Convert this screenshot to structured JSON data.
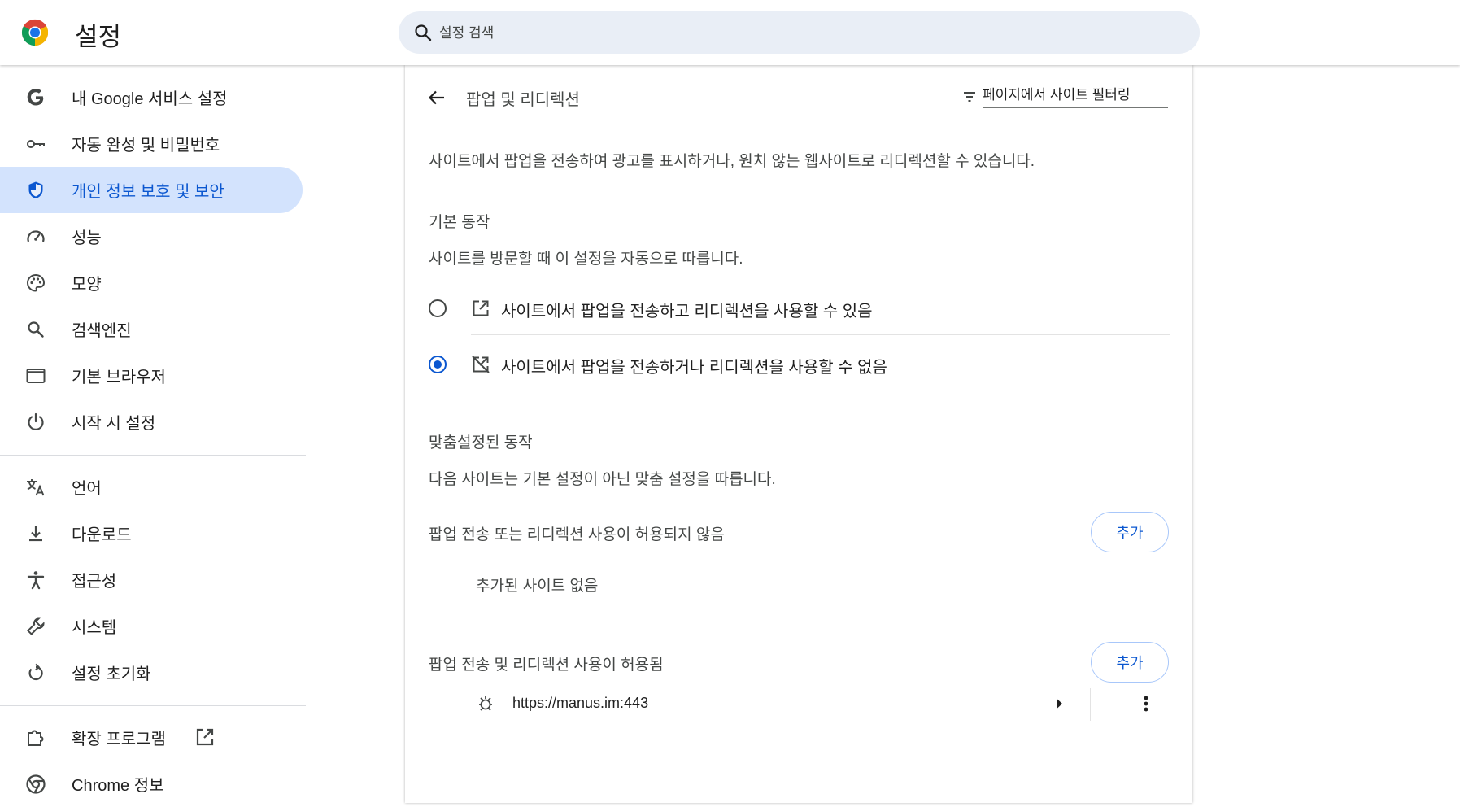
{
  "header": {
    "title": "설정",
    "search_placeholder": "설정 검색"
  },
  "sidebar": {
    "items": [
      {
        "label": "내 Google 서비스 설정",
        "icon": "google-g-icon"
      },
      {
        "label": "자동 완성 및 비밀번호",
        "icon": "key-icon"
      },
      {
        "label": "개인 정보 보호 및 보안",
        "icon": "shield-icon",
        "active": true
      },
      {
        "label": "성능",
        "icon": "speedometer-icon"
      },
      {
        "label": "모양",
        "icon": "palette-icon"
      },
      {
        "label": "검색엔진",
        "icon": "search-icon"
      },
      {
        "label": "기본 브라우저",
        "icon": "browser-window-icon"
      },
      {
        "label": "시작 시 설정",
        "icon": "power-icon"
      },
      {
        "label": "언어",
        "icon": "translate-icon"
      },
      {
        "label": "다운로드",
        "icon": "download-icon"
      },
      {
        "label": "접근성",
        "icon": "accessibility-icon"
      },
      {
        "label": "시스템",
        "icon": "wrench-icon"
      },
      {
        "label": "설정 초기화",
        "icon": "reset-icon"
      },
      {
        "label": "확장 프로그램",
        "icon": "puzzle-icon"
      },
      {
        "label": "Chrome 정보",
        "icon": "chrome-icon"
      }
    ]
  },
  "main": {
    "title": "팝업 및 리디렉션",
    "filter_placeholder": "페이지에서 사이트 필터링",
    "description": "사이트에서 팝업을 전송하여 광고를 표시하거나, 원치 않는 웹사이트로 리디렉션할 수 있습니다.",
    "default_behavior": {
      "title": "기본 동작",
      "subtitle": "사이트를 방문할 때 이 설정을 자동으로 따릅니다.",
      "options": [
        {
          "label": "사이트에서 팝업을 전송하고 리디렉션을 사용할 수 있음",
          "icon": "open-in-new-icon",
          "checked": false
        },
        {
          "label": "사이트에서 팝업을 전송하거나 리디렉션을 사용할 수 없음",
          "icon": "popup-blocked-icon",
          "checked": true
        }
      ]
    },
    "custom_behavior": {
      "title": "맞춤설정된 동작",
      "subtitle": "다음 사이트는 기본 설정이 아닌 맞춤 설정을 따릅니다.",
      "blocked": {
        "title": "팝업 전송 또는 리디렉션 사용이 허용되지 않음",
        "add_label": "추가",
        "empty": "추가된 사이트 없음"
      },
      "allowed": {
        "title": "팝업 전송 및 리디렉션 사용이 허용됨",
        "add_label": "추가",
        "sites": [
          {
            "url": "https://manus.im:443",
            "icon": "site-favicon-icon"
          }
        ]
      }
    }
  },
  "colors": {
    "accent": "#0b57d0",
    "active_nav_bg": "#d3e3fd",
    "search_bg": "#e9eef6"
  }
}
